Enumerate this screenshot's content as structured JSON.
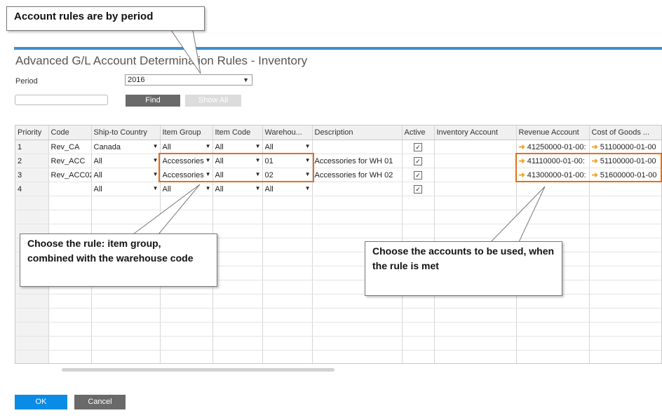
{
  "window": {
    "title": "Advanced G/L Account Determination Rules - Inventory",
    "accent_color": "#3b8fcf"
  },
  "filters": {
    "period_label": "Period",
    "period_value": "2016",
    "find_label": "Find",
    "show_all_label": "Show All"
  },
  "table": {
    "columns": [
      "Priority",
      "Code",
      "Ship-to Country",
      "Item Group",
      "Item Code",
      "Warehou...",
      "Description",
      "Active",
      "Inventory Account",
      "Revenue Account",
      "Cost of Goods ..."
    ],
    "rows": [
      {
        "priority": "1",
        "code": "Rev_CA",
        "country": "Canada",
        "item_group": "All",
        "item_code": "All",
        "warehouse": "All",
        "description": "",
        "active": true,
        "inventory_account": "",
        "revenue_account": "41250000-01-00:",
        "cogs_account": "51100000-01-00"
      },
      {
        "priority": "2",
        "code": "Rev_ACC",
        "country": "All",
        "item_group": "Accessories",
        "item_code": "All",
        "warehouse": "01",
        "description": "Accessories for WH 01",
        "active": true,
        "inventory_account": "",
        "revenue_account": "41110000-01-00:",
        "cogs_account": "51100000-01-00"
      },
      {
        "priority": "3",
        "code": "Rev_ACC02",
        "country": "All",
        "item_group": "Accessories",
        "item_code": "All",
        "warehouse": "02",
        "description": "Accessories for WH 02",
        "active": true,
        "inventory_account": "",
        "revenue_account": "41300000-01-00:",
        "cogs_account": "51600000-01-00"
      },
      {
        "priority": "4",
        "code": "",
        "country": "All",
        "item_group": "All",
        "item_code": "All",
        "warehouse": "All",
        "description": "",
        "active": true,
        "inventory_account": "",
        "revenue_account": "",
        "cogs_account": ""
      }
    ]
  },
  "footer": {
    "ok_label": "OK",
    "cancel_label": "Cancel"
  },
  "annotations": {
    "top_callout": "Account rules are by period",
    "rule_callout": "Choose the rule: item group, combined with the warehouse code",
    "accounts_callout": "Choose the accounts to be used, when the rule is met",
    "highlight_color": "#e0701e"
  }
}
